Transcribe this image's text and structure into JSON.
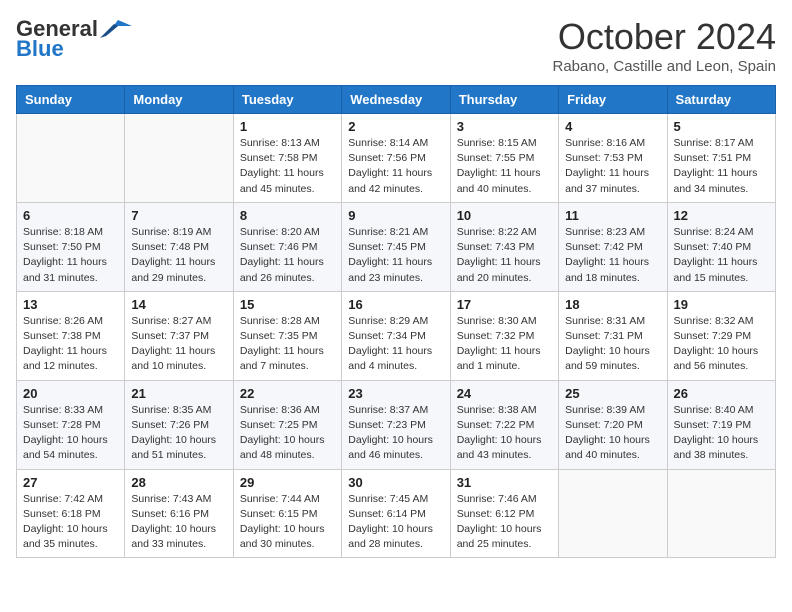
{
  "header": {
    "logo_general": "General",
    "logo_blue": "Blue",
    "month_title": "October 2024",
    "location": "Rabano, Castille and Leon, Spain"
  },
  "days_of_week": [
    "Sunday",
    "Monday",
    "Tuesday",
    "Wednesday",
    "Thursday",
    "Friday",
    "Saturday"
  ],
  "weeks": [
    [
      {
        "day": "",
        "info": ""
      },
      {
        "day": "",
        "info": ""
      },
      {
        "day": "1",
        "info": "Sunrise: 8:13 AM\nSunset: 7:58 PM\nDaylight: 11 hours and 45 minutes."
      },
      {
        "day": "2",
        "info": "Sunrise: 8:14 AM\nSunset: 7:56 PM\nDaylight: 11 hours and 42 minutes."
      },
      {
        "day": "3",
        "info": "Sunrise: 8:15 AM\nSunset: 7:55 PM\nDaylight: 11 hours and 40 minutes."
      },
      {
        "day": "4",
        "info": "Sunrise: 8:16 AM\nSunset: 7:53 PM\nDaylight: 11 hours and 37 minutes."
      },
      {
        "day": "5",
        "info": "Sunrise: 8:17 AM\nSunset: 7:51 PM\nDaylight: 11 hours and 34 minutes."
      }
    ],
    [
      {
        "day": "6",
        "info": "Sunrise: 8:18 AM\nSunset: 7:50 PM\nDaylight: 11 hours and 31 minutes."
      },
      {
        "day": "7",
        "info": "Sunrise: 8:19 AM\nSunset: 7:48 PM\nDaylight: 11 hours and 29 minutes."
      },
      {
        "day": "8",
        "info": "Sunrise: 8:20 AM\nSunset: 7:46 PM\nDaylight: 11 hours and 26 minutes."
      },
      {
        "day": "9",
        "info": "Sunrise: 8:21 AM\nSunset: 7:45 PM\nDaylight: 11 hours and 23 minutes."
      },
      {
        "day": "10",
        "info": "Sunrise: 8:22 AM\nSunset: 7:43 PM\nDaylight: 11 hours and 20 minutes."
      },
      {
        "day": "11",
        "info": "Sunrise: 8:23 AM\nSunset: 7:42 PM\nDaylight: 11 hours and 18 minutes."
      },
      {
        "day": "12",
        "info": "Sunrise: 8:24 AM\nSunset: 7:40 PM\nDaylight: 11 hours and 15 minutes."
      }
    ],
    [
      {
        "day": "13",
        "info": "Sunrise: 8:26 AM\nSunset: 7:38 PM\nDaylight: 11 hours and 12 minutes."
      },
      {
        "day": "14",
        "info": "Sunrise: 8:27 AM\nSunset: 7:37 PM\nDaylight: 11 hours and 10 minutes."
      },
      {
        "day": "15",
        "info": "Sunrise: 8:28 AM\nSunset: 7:35 PM\nDaylight: 11 hours and 7 minutes."
      },
      {
        "day": "16",
        "info": "Sunrise: 8:29 AM\nSunset: 7:34 PM\nDaylight: 11 hours and 4 minutes."
      },
      {
        "day": "17",
        "info": "Sunrise: 8:30 AM\nSunset: 7:32 PM\nDaylight: 11 hours and 1 minute."
      },
      {
        "day": "18",
        "info": "Sunrise: 8:31 AM\nSunset: 7:31 PM\nDaylight: 10 hours and 59 minutes."
      },
      {
        "day": "19",
        "info": "Sunrise: 8:32 AM\nSunset: 7:29 PM\nDaylight: 10 hours and 56 minutes."
      }
    ],
    [
      {
        "day": "20",
        "info": "Sunrise: 8:33 AM\nSunset: 7:28 PM\nDaylight: 10 hours and 54 minutes."
      },
      {
        "day": "21",
        "info": "Sunrise: 8:35 AM\nSunset: 7:26 PM\nDaylight: 10 hours and 51 minutes."
      },
      {
        "day": "22",
        "info": "Sunrise: 8:36 AM\nSunset: 7:25 PM\nDaylight: 10 hours and 48 minutes."
      },
      {
        "day": "23",
        "info": "Sunrise: 8:37 AM\nSunset: 7:23 PM\nDaylight: 10 hours and 46 minutes."
      },
      {
        "day": "24",
        "info": "Sunrise: 8:38 AM\nSunset: 7:22 PM\nDaylight: 10 hours and 43 minutes."
      },
      {
        "day": "25",
        "info": "Sunrise: 8:39 AM\nSunset: 7:20 PM\nDaylight: 10 hours and 40 minutes."
      },
      {
        "day": "26",
        "info": "Sunrise: 8:40 AM\nSunset: 7:19 PM\nDaylight: 10 hours and 38 minutes."
      }
    ],
    [
      {
        "day": "27",
        "info": "Sunrise: 7:42 AM\nSunset: 6:18 PM\nDaylight: 10 hours and 35 minutes."
      },
      {
        "day": "28",
        "info": "Sunrise: 7:43 AM\nSunset: 6:16 PM\nDaylight: 10 hours and 33 minutes."
      },
      {
        "day": "29",
        "info": "Sunrise: 7:44 AM\nSunset: 6:15 PM\nDaylight: 10 hours and 30 minutes."
      },
      {
        "day": "30",
        "info": "Sunrise: 7:45 AM\nSunset: 6:14 PM\nDaylight: 10 hours and 28 minutes."
      },
      {
        "day": "31",
        "info": "Sunrise: 7:46 AM\nSunset: 6:12 PM\nDaylight: 10 hours and 25 minutes."
      },
      {
        "day": "",
        "info": ""
      },
      {
        "day": "",
        "info": ""
      }
    ]
  ]
}
